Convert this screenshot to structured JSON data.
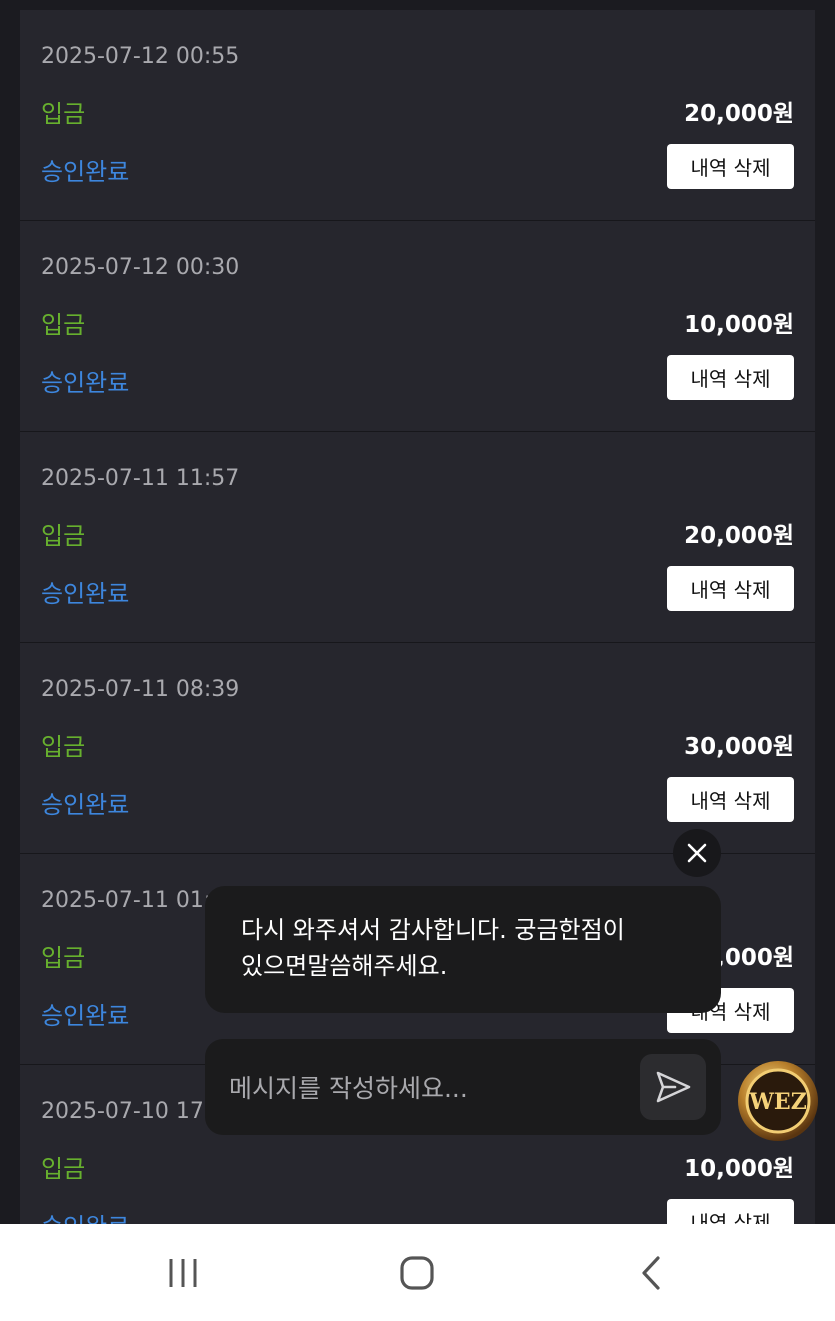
{
  "transactions": [
    {
      "date": "2025-07-12 00:55",
      "type": "입금",
      "amount": "20,000원",
      "status": "승인완료",
      "delete_label": "내역 삭제"
    },
    {
      "date": "2025-07-12 00:30",
      "type": "입금",
      "amount": "10,000원",
      "status": "승인완료",
      "delete_label": "내역 삭제"
    },
    {
      "date": "2025-07-11 11:57",
      "type": "입금",
      "amount": "20,000원",
      "status": "승인완료",
      "delete_label": "내역 삭제"
    },
    {
      "date": "2025-07-11 08:39",
      "type": "입금",
      "amount": "30,000원",
      "status": "승인완료",
      "delete_label": "내역 삭제"
    },
    {
      "date": "2025-07-11 01:1",
      "type": "입금",
      "amount": "0,000원",
      "status": "승인완료",
      "delete_label": "내역 삭제"
    },
    {
      "date": "2025-07-10 17:",
      "type": "입금",
      "amount": "10,000원",
      "status": "승인완료",
      "delete_label": "내역 삭제"
    }
  ],
  "chat": {
    "message_line1": "다시 와주셔서 감사합니다. 궁금한점이",
    "message_line2": "있으면말씀해주세요.",
    "input_placeholder": "메시지를 작성하세요...",
    "logo_text": "WEZ"
  },
  "colors": {
    "deposit": "#67b02e",
    "approved": "#3d86dd",
    "card_bg": "#26262d",
    "page_bg": "#1b1b20"
  },
  "icons": {
    "close": "close-icon",
    "send": "send-icon",
    "nav_recent": "recent-apps-icon",
    "nav_home": "home-icon",
    "nav_back": "back-icon"
  }
}
